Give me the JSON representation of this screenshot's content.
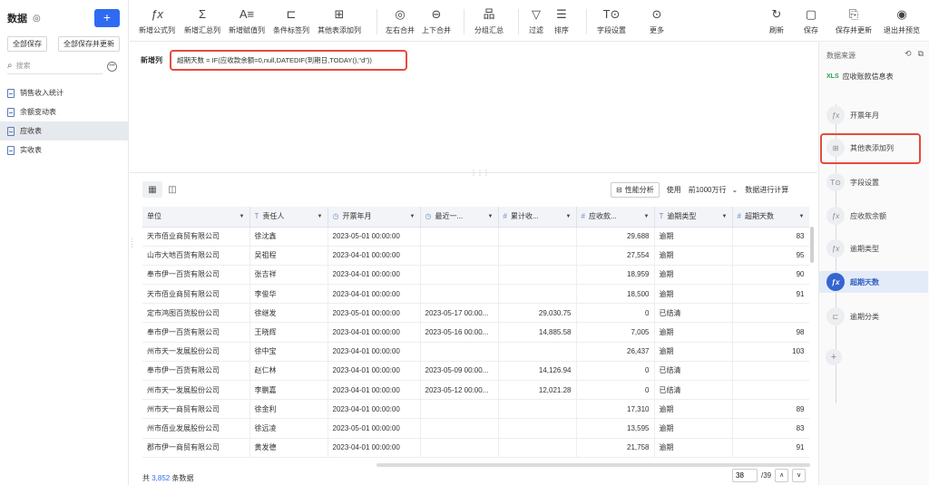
{
  "sidebar": {
    "title": "数据",
    "save_all": "全部保存",
    "save_all_update": "全部保存并更新",
    "search_placeholder": "搜索",
    "items": [
      {
        "label": "销售收入统计"
      },
      {
        "label": "余额变动表"
      },
      {
        "label": "应收表"
      },
      {
        "label": "实收表"
      }
    ],
    "active_index": 2
  },
  "toolbar": {
    "items": [
      {
        "label": "新增公式列",
        "icon": "fx-icon"
      },
      {
        "label": "新增汇总列",
        "icon": "sigma-icon"
      },
      {
        "label": "新增赋值列",
        "icon": "assign-icon"
      },
      {
        "label": "条件标签列",
        "icon": "condition-tag-icon"
      },
      {
        "label": "其他表添加列",
        "icon": "add-column-icon"
      },
      {
        "label": "左右合并",
        "icon": "merge-lr-icon"
      },
      {
        "label": "上下合并",
        "icon": "merge-ud-icon"
      },
      {
        "label": "分组汇总",
        "icon": "group-summary-icon"
      },
      {
        "label": "过滤",
        "icon": "filter-icon"
      },
      {
        "label": "排序",
        "icon": "sort-icon"
      },
      {
        "label": "字段设置",
        "icon": "field-settings-icon"
      },
      {
        "label": "更多",
        "icon": "more-icon"
      },
      {
        "label": "刷新",
        "icon": "refresh-icon"
      },
      {
        "label": "保存",
        "icon": "save-icon"
      },
      {
        "label": "保存并更新",
        "icon": "save-update-icon"
      },
      {
        "label": "退出并预览",
        "icon": "exit-preview-icon"
      }
    ]
  },
  "formula": {
    "label": "新增列",
    "name": "超期天数",
    "expression": " = IF(应收款余额=0,null,DATEDIF(到期日,TODAY(),\"d\"))"
  },
  "table_toolbar": {
    "perf_label": "性能分析",
    "use_label": "使用",
    "rows_option": "前1000万行",
    "compute_label": "数据进行计算"
  },
  "table": {
    "columns": [
      {
        "label": "单位",
        "type": ""
      },
      {
        "label": "责任人",
        "type": "T"
      },
      {
        "label": "开票年月",
        "type": "clock"
      },
      {
        "label": "最近一...",
        "type": "clock"
      },
      {
        "label": "累计收...",
        "type": "#"
      },
      {
        "label": "应收款...",
        "type": "#"
      },
      {
        "label": "逾期类型",
        "type": "T"
      },
      {
        "label": "超期天数",
        "type": "#"
      }
    ],
    "rows": [
      [
        "天市佰业商贸有限公司",
        "徐沈鑫",
        "2023-05-01 00:00:00",
        "",
        "",
        "29,688",
        "逾期",
        "83"
      ],
      [
        "山市大地百货有限公司",
        "吴祖程",
        "2023-04-01 00:00:00",
        "",
        "",
        "27,554",
        "逾期",
        "95"
      ],
      [
        "奉市伊一百货有限公司",
        "张吉祥",
        "2023-04-01 00:00:00",
        "",
        "",
        "18,959",
        "逾期",
        "90"
      ],
      [
        "天市佰业商贸有限公司",
        "李俊华",
        "2023-04-01 00:00:00",
        "",
        "",
        "18,500",
        "逾期",
        "91"
      ],
      [
        "定市鸿图百货股份公司",
        "徐继发",
        "2023-05-01 00:00:00",
        "2023-05-17 00:00...",
        "29,030.75",
        "0",
        "已结清",
        ""
      ],
      [
        "奉市伊一百货有限公司",
        "王晓辉",
        "2023-04-01 00:00:00",
        "2023-05-16 00:00...",
        "14,885.58",
        "7,005",
        "逾期",
        "98"
      ],
      [
        "州市天一发展股份公司",
        "徐中宝",
        "2023-04-01 00:00:00",
        "",
        "",
        "26,437",
        "逾期",
        "103"
      ],
      [
        "奉市伊一百货有限公司",
        "赵仁林",
        "2023-04-01 00:00:00",
        "2023-05-09 00:00...",
        "14,126.94",
        "0",
        "已结清",
        ""
      ],
      [
        "州市天一发展股份公司",
        "李鹏嘉",
        "2023-04-01 00:00:00",
        "2023-05-12 00:00...",
        "12,021.28",
        "0",
        "已结清",
        ""
      ],
      [
        "州市天一商贸有限公司",
        "徐金利",
        "2023-04-01 00:00:00",
        "",
        "",
        "17,310",
        "逾期",
        "89"
      ],
      [
        "州市佰业发展股份公司",
        "徐远凌",
        "2023-05-01 00:00:00",
        "",
        "",
        "13,595",
        "逾期",
        "83"
      ],
      [
        "郡市伊一商贸有限公司",
        "黄发德",
        "2023-04-01 00:00:00",
        "",
        "",
        "21,758",
        "逾期",
        "91"
      ]
    ]
  },
  "footer": {
    "prefix": "共 ",
    "count": "3,852",
    "suffix": " 条数据",
    "page_value": "38",
    "page_total": "/39"
  },
  "right_panel": {
    "title": "数据来源",
    "source_badge": "XLS",
    "source": "应收账款信息表",
    "steps": [
      {
        "label": "开票年月",
        "icon": "fx-icon"
      },
      {
        "label": "其他表添加列",
        "icon": "add-column-icon"
      },
      {
        "label": "字段设置",
        "icon": "field-settings-icon"
      },
      {
        "label": "应收款余额",
        "icon": "fx-icon"
      },
      {
        "label": "逾期类型",
        "icon": "fx-icon"
      },
      {
        "label": "超期天数",
        "icon": "fx-icon"
      },
      {
        "label": "逾期分类",
        "icon": "condition-tag-icon"
      }
    ],
    "active_step": 5
  },
  "colors": {
    "accent": "#2f6bf2",
    "highlight_box": "#e54b3c",
    "formula_field": "#1f4ec8"
  }
}
